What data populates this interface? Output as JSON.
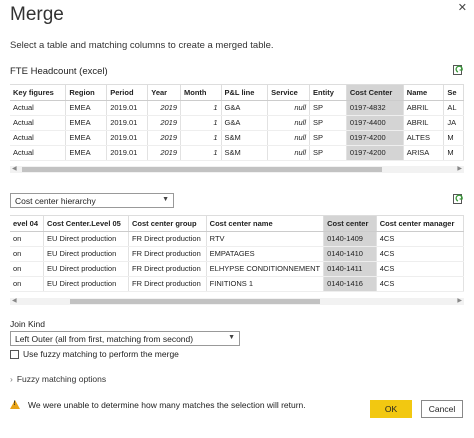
{
  "dialog": {
    "title": "Merge",
    "close_glyph": "✕",
    "subtitle": "Select a table and matching columns to create a merged table."
  },
  "table1": {
    "title": "FTE Headcount (excel)",
    "refresh_icon": "refresh-icon",
    "columns": [
      "Key figures",
      "Region",
      "Period",
      "Year",
      "Month",
      "P&L line",
      "Service",
      "Entity",
      "Cost Center",
      "Name",
      "Se"
    ],
    "selected_column": "Cost Center",
    "rows": [
      [
        "Actual",
        "EMEA",
        "2019.01",
        "2019",
        "1",
        "G&A",
        "null",
        "SP",
        "0197-4832",
        "ABRIL",
        "AL"
      ],
      [
        "Actual",
        "EMEA",
        "2019.01",
        "2019",
        "1",
        "G&A",
        "null",
        "SP",
        "0197-4400",
        "ABRIL",
        "JA"
      ],
      [
        "Actual",
        "EMEA",
        "2019.01",
        "2019",
        "1",
        "S&M",
        "null",
        "SP",
        "0197-4200",
        "ALTES",
        "M"
      ],
      [
        "Actual",
        "EMEA",
        "2019.01",
        "2019",
        "1",
        "S&M",
        "null",
        "SP",
        "0197-4200",
        "ARISA",
        "M"
      ]
    ]
  },
  "table2": {
    "selector_value": "Cost center hierarchy",
    "refresh_icon": "refresh-icon",
    "columns": [
      "evel 04",
      "Cost Center.Level 05",
      "Cost center group",
      "Cost center name",
      "Cost center",
      "Cost center manager"
    ],
    "selected_column": "Cost center",
    "rows": [
      [
        "on",
        "EU Direct production",
        "FR Direct production",
        "RTV",
        "0140-1409",
        "4CS"
      ],
      [
        "on",
        "EU Direct production",
        "FR Direct production",
        "EMPATAGES",
        "0140-1410",
        "4CS"
      ],
      [
        "on",
        "EU Direct production",
        "FR Direct production",
        "ELHYPSE CONDITIONNEMENT",
        "0140-1411",
        "4CS"
      ],
      [
        "on",
        "EU Direct production",
        "FR Direct production",
        "FINITIONS 1",
        "0140-1416",
        "4CS"
      ]
    ]
  },
  "join": {
    "label": "Join Kind",
    "value": "Left Outer (all from first, matching from second)"
  },
  "fuzzy": {
    "checkbox_label": "Use fuzzy matching to perform the merge",
    "checked": false,
    "options_label": "Fuzzy matching options"
  },
  "status": {
    "warning": "We were unable to determine how many matches the selection will return."
  },
  "buttons": {
    "ok": "OK",
    "cancel": "Cancel"
  },
  "colors": {
    "ok_button": "#f2c811",
    "warning_icon": "#e8a317",
    "selected_column": "#d4d4d4"
  }
}
